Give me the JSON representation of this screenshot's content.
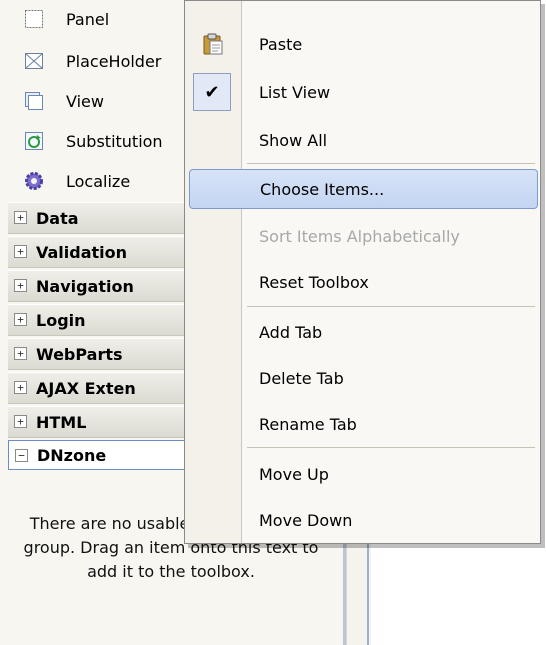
{
  "toolbox": {
    "items": [
      {
        "label": "Panel",
        "icon": "panel-icon"
      },
      {
        "label": "PlaceHolder",
        "icon": "placeholder-icon"
      },
      {
        "label": "View",
        "icon": "view-icon"
      },
      {
        "label": "Substitution",
        "icon": "substitution-icon"
      },
      {
        "label": "Localize",
        "icon": "gear-icon"
      }
    ],
    "categories": [
      {
        "label": "Data",
        "expander": "+"
      },
      {
        "label": "Validation",
        "expander": "+"
      },
      {
        "label": "Navigation",
        "expander": "+"
      },
      {
        "label": "Login",
        "expander": "+"
      },
      {
        "label": "WebParts",
        "expander": "+"
      },
      {
        "label": "AJAX Exten",
        "expander": "+"
      },
      {
        "label": "HTML",
        "expander": "+"
      },
      {
        "label": "DNzone",
        "expander": "−"
      }
    ],
    "empty_message": "There are no usable controls in this group. Drag an item onto this text to add it to the toolbox."
  },
  "context_menu": {
    "items": [
      {
        "label": "Paste",
        "icon": "clipboard-icon"
      },
      {
        "label": "List View",
        "checked": true
      },
      {
        "label": "Show All"
      },
      {
        "label": "Choose Items...",
        "hover": true
      },
      {
        "label": "Sort Items Alphabetically",
        "disabled": true
      },
      {
        "label": "Reset Toolbox"
      },
      {
        "label": "Add Tab"
      },
      {
        "label": "Delete Tab"
      },
      {
        "label": "Rename Tab"
      },
      {
        "label": "Move Up"
      },
      {
        "label": "Move Down"
      }
    ],
    "check_glyph": "✔"
  },
  "colors": {
    "hover_accent": "#c3d5f2",
    "disabled_text": "#a8a8a8",
    "category_bg": "#dcdbd2"
  }
}
